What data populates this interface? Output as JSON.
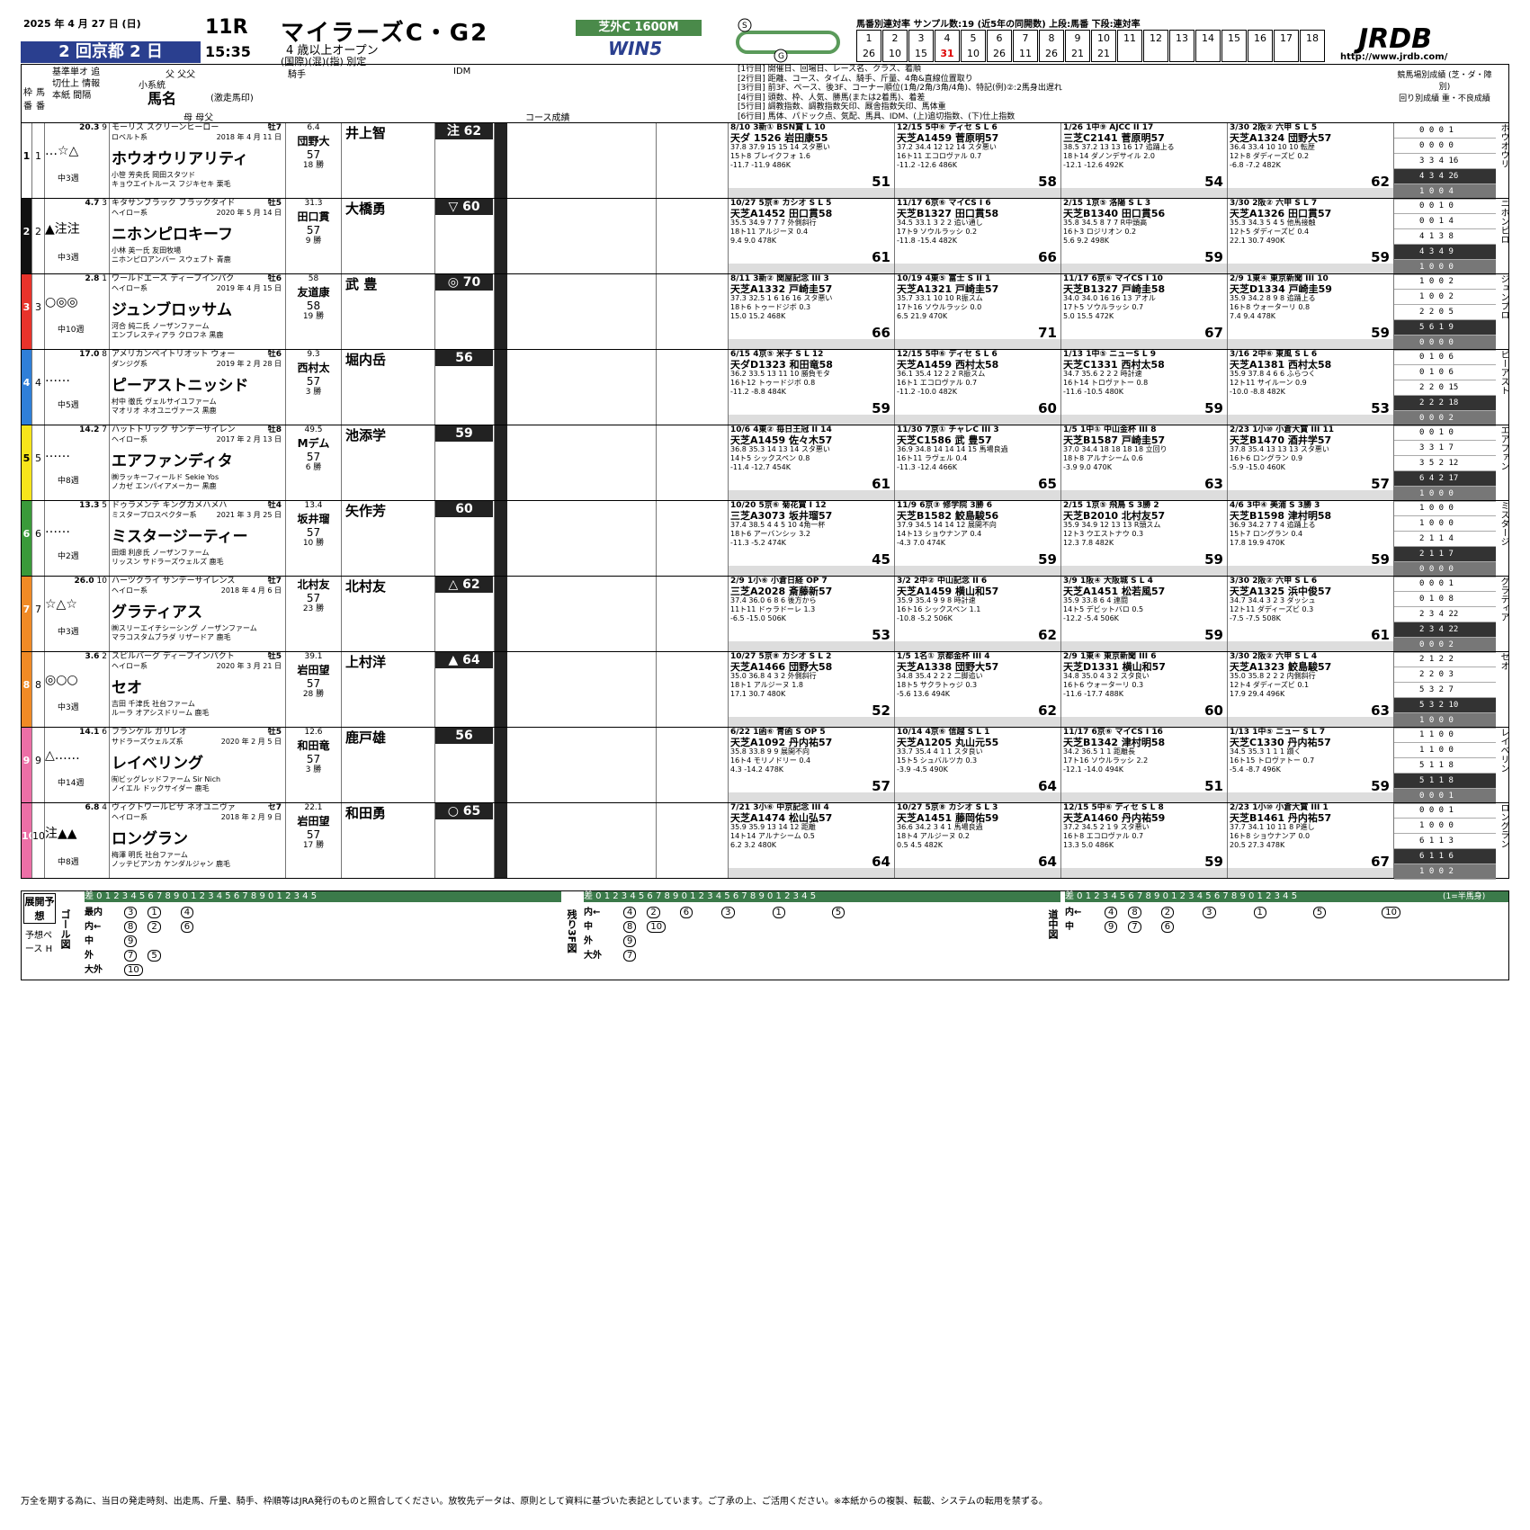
{
  "header": {
    "date": "2025 年 4 月 27 日 (日)",
    "meeting": "2 回京都 2 日",
    "race_no": "11R",
    "time": "15:35",
    "race_name": "マイラーズC・G2",
    "conditions_1": "4 歳以上オープン",
    "conditions_2": "(国際)(混)(指) 別定",
    "course": "芝外C 1600M",
    "win5": "WIN5",
    "stats_title": "馬番別連対率 サンプル数:19 (近5年の同開数) 上段:馬番 下段:連対率",
    "umaban_labels": [
      "1",
      "2",
      "3",
      "4",
      "5",
      "6",
      "7",
      "8",
      "9",
      "10",
      "11",
      "12",
      "13",
      "14",
      "15",
      "16",
      "17",
      "18"
    ],
    "rates": [
      "26",
      "10",
      "15",
      "31",
      "10",
      "26",
      "11",
      "26",
      "21",
      "21",
      "",
      "",
      "",
      "",
      "",
      "",
      "",
      ""
    ],
    "brand": "JRDB",
    "url": "http://www.jrdb.com/"
  },
  "columns": {
    "waku": "枠番",
    "umaban": "馬番",
    "mark_head": "基準単オ 追切仕上 情報本紙 間隔",
    "sire": "父 父父",
    "line": "小系統",
    "horse": "馬名",
    "horse_sub": "(激走馬印)",
    "dam": "母 母父",
    "jockey": "騎手",
    "idm": "IDM",
    "course_perf": "コース成績",
    "legend1": "[1行目] 開催日、回場日、レース名、クラス、着順",
    "legend2": "[2行目] 距離、コース、タイム、騎手、斤量、4角&直線位置取り",
    "legend3": "[3行目] 前3F、ペース、後3F、コーナー順位(1角/2角/3角/4角)、特記(例)②:2馬身出遅れ",
    "legend4": "[4行目] 頭数、枠、人気、勝馬(または2着馬)、着差",
    "legend5": "[5行目] 調教指数、調教指数矢印、厩舎指数矢印、馬体重",
    "legend6": "[6行目] 馬体、パドック点、気配、馬具、IDM、(上)追切指数、(下)仕上指数",
    "ranking_head": "競馬場別成績 (芝・ダ・障別)",
    "ranking_sub": "回り別成績 重・不良成績"
  },
  "horses": [
    {
      "waku": "1",
      "no": "1",
      "color": "#ffffff",
      "tc": "#000",
      "odds": "20.3",
      "pop": "9",
      "marks": "…☆△",
      "sire": "モーリス スクリーンヒーロー",
      "line": "ロベルト系",
      "age": "牡7",
      "birth": "2018 年 4 月 11 日",
      "name": "ホウオウリアリティ",
      "breeder": "小笹 芳央氏 岡田スタツド",
      "dam": "キョウエイトルース フジキセキ 栗毛",
      "interval": "中3週",
      "jockey": "井上智",
      "rate": "6.4",
      "trainer": "団野大",
      "weight": "57",
      "wins": "18 勝",
      "idm": "注 62",
      "place": "京芝",
      "rank": [
        "0 0 0 1",
        "0 0 0 0",
        "3 3 4 16",
        "4 3 4 26",
        "1 0 0 4"
      ],
      "vname": "ホウオウリ",
      "races": [
        {
          "t": "8/10 3新① BSN賞 L 10",
          "d": "天ダ 1526 岩田康55",
          "r": "37.8 37.9 15 15 14 スタ悪い",
          "n": "15ト8 ブレイクフォ 1.6",
          "w": "-11.7 -11.9 486K",
          "i": "51"
        },
        {
          "t": "12/15 5中⑥ ディセ S L 6",
          "d": "天芝A1459 菅原明57",
          "r": "37.2 34.4 12 12 14 スタ悪い",
          "n": "16ト11 エコロヴァル 0.7",
          "w": "-11.2 -12.6 486K",
          "i": "58"
        },
        {
          "t": "1/26 1中⑨ AJCC II 17",
          "d": "三芝C2141 菅原明57",
          "r": "38.5 37.2 13 13 16 17 追踊上る",
          "n": "18ト14 ダノンデサイル 2.0",
          "w": "-12.1 -12.6 492K",
          "i": "54"
        },
        {
          "t": "3/30 2阪② 六甲 S L 5",
          "d": "天芝A1324 団野大57",
          "r": "36.4 33.4 10 10 10 転歴",
          "n": "12ト8 ダディーズビ 0.2",
          "w": "-6.8 -7.2 482K",
          "i": "62"
        }
      ]
    },
    {
      "waku": "2",
      "no": "2",
      "color": "#111111",
      "tc": "#fff",
      "odds": "4.7",
      "pop": "3",
      "marks": "▲注注",
      "sire": "キタサンブラック ブラックタイド",
      "line": "ヘイロー系",
      "age": "牡5",
      "birth": "2020 年 5 月 14 日",
      "name": "ニホンピロキーフ",
      "breeder": "小林 英一氏 友田牧場",
      "dam": "ニホンピロアンバー スウェプト 青鹿",
      "interval": "中3週",
      "jockey": "大橋勇",
      "rate": "31.3",
      "trainer": "田口貫",
      "weight": "57",
      "wins": "9 勝",
      "idm": "▽ 60",
      "place": "京芝",
      "rank": [
        "0 0 1 0",
        "0 0 1 4",
        "4 1 3 8",
        "4 3 4 9",
        "1 0 0 0"
      ],
      "vname": "ニホンピロ",
      "races": [
        {
          "t": "10/27 5京⑧ カシオ S L 5",
          "d": "天芝A1452 田口貫58",
          "r": "35.5 34.9 7 7 7 外側斜行",
          "n": "18ト11 アルジーヌ 0.4",
          "w": "9.4 9.0 478K",
          "i": "61"
        },
        {
          "t": "11/17 6京⑥ マイCS I 6",
          "d": "天芝B1327 田口貫58",
          "r": "34.5 33.1 3 2 2 追い通し",
          "n": "17ト9 ソウルラッシ 0.2",
          "w": "-11.8 -15.4 482K",
          "i": "66"
        },
        {
          "t": "2/15 1京⑤ 洛陽 S L 3",
          "d": "天芝B1340 田口貫56",
          "r": "35.8 34.5 8 7 7 R中頭高",
          "n": "16ト3 ロジリオン 0.2",
          "w": "5.6 9.2 498K",
          "i": "59"
        },
        {
          "t": "3/30 2阪② 六甲 S L 7",
          "d": "天芝A1326 田口貫57",
          "r": "35.3 34.3 5 4 5 他馬接触",
          "n": "12ト5 ダディーズビ 0.4",
          "w": "22.1 30.7 490K",
          "i": "59"
        }
      ]
    },
    {
      "waku": "3",
      "no": "3",
      "color": "#e8332b",
      "tc": "#fff",
      "odds": "2.8",
      "pop": "1",
      "marks": "○◎◎",
      "sire": "ワールドエース ディープインパク",
      "line": "ヘイロー系",
      "age": "牡6",
      "birth": "2019 年 4 月 15 日",
      "name": "ジュンブロッサム",
      "breeder": "河合 純二氏 ノーザンファーム",
      "dam": "エンブレスティアラ クロフネ 黒鹿",
      "interval": "中10週",
      "jockey": "武 豊",
      "rate": "58",
      "trainer": "友道康",
      "weight": "58",
      "wins": "19 勝",
      "idm": "◎ 70",
      "place": "京芝",
      "rank": [
        "1 0 0 2",
        "1 0 0 2",
        "2 2 0 5",
        "5 6 1 9",
        "0 0 0 0"
      ],
      "vname": "ジュンブロ",
      "races": [
        {
          "t": "8/11 3新② 関屋記念 III 3",
          "d": "天芝A1332 戸崎圭57",
          "r": "37.3 32.5 1 6 16 16 スタ悪い",
          "n": "18ト6 トゥードジボ 0.3",
          "w": "15.0 15.2 468K",
          "i": "66"
        },
        {
          "t": "10/19 4東⑤ 富士 S II 1",
          "d": "天芝A1321 戸崎圭57",
          "r": "35.7 33.1 10 10 R振スム",
          "n": "17ト16 ソウルラッシ 0.0",
          "w": "6.5 21.9 470K",
          "i": "71"
        },
        {
          "t": "11/17 6京⑥ マイCS I 10",
          "d": "天芝B1327 戸崎圭58",
          "r": "34.0 34.0 16 16 13 アオル",
          "n": "17ト5 ソウルラッシ 0.7",
          "w": "5.0 15.5 472K",
          "i": "67"
        },
        {
          "t": "2/9 1東④ 東京新聞 III 10",
          "d": "天芝D1334 戸崎圭59",
          "r": "35.9 34.2 8 9 8 追踊上る",
          "n": "16ト8 ウォーターリ 0.8",
          "w": "7.4 9.4 478K",
          "i": "59"
        }
      ]
    },
    {
      "waku": "4",
      "no": "4",
      "color": "#2f7fd8",
      "tc": "#fff",
      "odds": "17.0",
      "pop": "8",
      "marks": "……",
      "sire": "アメリカンペイトリオット ウォー",
      "line": "ダンジグ系",
      "age": "牡6",
      "birth": "2019 年 2 月 28 日",
      "name": "ピーアストニッシド",
      "breeder": "村中 徹氏 ヴェルサイユファーム",
      "dam": "マオリオ ネオユニヴァース 黒鹿",
      "interval": "中5週",
      "jockey": "堀内岳",
      "rate": "9.3",
      "trainer": "西村太",
      "weight": "57",
      "wins": "3 勝",
      "idm": "56",
      "place": "京芝",
      "rank": [
        "0 1 0 6",
        "0 1 0 6",
        "2 2 0 15",
        "2 2 2 18",
        "0 0 0 2"
      ],
      "vname": "ピーアスト",
      "races": [
        {
          "t": "6/15 4京⑤ 米子 S L 12",
          "d": "天ダD1323 和田竜58",
          "r": "36.2 33.5 13 11 10 勝負モタ",
          "n": "16ト12 トゥードジボ 0.8",
          "w": "-11.2 -8.8 484K",
          "i": "59"
        },
        {
          "t": "12/15 5中⑥ ディセ S L 6",
          "d": "天芝A1459 西村太58",
          "r": "36.1 35.4 12 2 2 R振スム",
          "n": "16ト1 エコロヴァル 0.7",
          "w": "-11.2 -10.0 482K",
          "i": "60"
        },
        {
          "t": "1/13 1中⑤ ニューS L 9",
          "d": "天芝C1331 西村太58",
          "r": "34.7 35.6 2 2 2 時計速",
          "n": "16ト14 トロヴァトー 0.8",
          "w": "-11.6 -10.5 480K",
          "i": "59"
        },
        {
          "t": "3/16 2中⑥ 東風 S L 6",
          "d": "天芝A1381 西村太58",
          "r": "35.9 37.8 4 6 6 ふらつく",
          "n": "12ト11 サイルーン 0.9",
          "w": "-10.0 -8.8 482K",
          "i": "53"
        }
      ]
    },
    {
      "waku": "5",
      "no": "5",
      "color": "#f7e51b",
      "tc": "#000",
      "odds": "14.2",
      "pop": "7",
      "marks": "……",
      "sire": "ハットトリック サンデーサイレン",
      "line": "ヘイロー系",
      "age": "牡8",
      "birth": "2017 年 2 月 13 日",
      "name": "エアファンディタ",
      "breeder": "㈱ラッキーフィールド Sekie Yos",
      "dam": "ノカゼ エンパイアメーカー 黒鹿",
      "interval": "中8週",
      "jockey": "池添学",
      "rate": "49.5",
      "trainer": "Mデム",
      "weight": "57",
      "wins": "6 勝",
      "idm": "59",
      "place": "京芝",
      "rank": [
        "0 0 1 0",
        "3 3 1 7",
        "3 5 2 12",
        "6 4 2 17",
        "1 0 0 0"
      ],
      "vname": "エアファン",
      "races": [
        {
          "t": "10/6 4東② 毎日王冠 II 14",
          "d": "天芝A1459 佐々木57",
          "r": "36.8 35.3 14 13 14 スタ悪い",
          "n": "14ト5 シックスペン 0.8",
          "w": "-11.4 -12.7 454K",
          "i": "61"
        },
        {
          "t": "11/30 7京① チャレC III 3",
          "d": "天芝C1586 武 豊57",
          "r": "36.9 34.8 14 14 14 15 馬場良過",
          "n": "16ト11 ラヴェル 0.4",
          "w": "-11.3 -12.4 466K",
          "i": "65"
        },
        {
          "t": "1/5 1中① 中山金杯 III 8",
          "d": "天芝B1587 戸崎圭57",
          "r": "37.0 34.4 18 18 18 18 立回り",
          "n": "18ト8 アルナシーム 0.6",
          "w": "-3.9 9.0 470K",
          "i": "63"
        },
        {
          "t": "2/23 1小⑩ 小倉大賞 III 11",
          "d": "天芝B1470 酒井学57",
          "r": "37.8 35.4 13 13 13 スタ悪い",
          "n": "16ト6 ロングラン 0.9",
          "w": "-5.9 -15.0 460K",
          "i": "57"
        }
      ]
    },
    {
      "waku": "6",
      "no": "6",
      "color": "#3a9a3a",
      "tc": "#fff",
      "odds": "13.3",
      "pop": "5",
      "marks": "……",
      "sire": "ドゥラメンテ キングカメハメハ",
      "line": "ミスタープロスペクター系",
      "age": "牡4",
      "birth": "2021 年 3 月 25 日",
      "name": "ミスタージーティー",
      "breeder": "田畑 利彦氏 ノーザンファーム",
      "dam": "リッスン サドラーズウェルズ 鹿毛",
      "interval": "中2週",
      "jockey": "矢作芳",
      "rate": "13.4",
      "trainer": "坂井瑠",
      "weight": "57",
      "wins": "10 勝",
      "idm": "60",
      "place": "京芝",
      "rank": [
        "1 0 0 0",
        "1 0 0 0",
        "2 1 1 4",
        "2 1 1 7",
        "0 0 0 0"
      ],
      "vname": "ミスタージ",
      "races": [
        {
          "t": "10/20 5京⑥ 菊花賞 I 12",
          "d": "三芝A3073 坂井瑠57",
          "r": "37.4 38.5 4 4 5 10 4角一杯",
          "n": "18ト6 アーバンシッ 3.2",
          "w": "-11.3 -5.2 474K",
          "i": "45"
        },
        {
          "t": "11/9 6京③ 修学院 3勝 6",
          "d": "天芝B1582 鮫島駿56",
          "r": "37.9 34.5 14 14 12 展開不向",
          "n": "14ト13 ショウナンア 0.4",
          "w": "-4.3 7.0 474K",
          "i": "59"
        },
        {
          "t": "2/15 1京⑤ 飛鳥 S 3勝 2",
          "d": "天芝B2010 北村友57",
          "r": "35.9 34.9 12 13 13 R頭スム",
          "n": "12ト3 ウエストナウ 0.3",
          "w": "12.3 7.8 482K",
          "i": "59"
        },
        {
          "t": "4/6 3中④ 美浦 S 3勝 3",
          "d": "天芝B1598 津村明58",
          "r": "36.9 34.2 7 7 4 追踊上る",
          "n": "15ト7 ロングラン 0.4",
          "w": "17.8 19.9 470K",
          "i": "59"
        }
      ]
    },
    {
      "waku": "7",
      "no": "7",
      "color": "#f08a25",
      "tc": "#fff",
      "odds": "26.0",
      "pop": "10",
      "marks": "☆△☆",
      "sire": "ハーツクライ サンデーサイレンス",
      "line": "ヘイロー系",
      "age": "牡7",
      "birth": "2018 年 4 月 6 日",
      "name": "グラティアス",
      "breeder": "㈱スリーエイチシーシング ノーザンファーム",
      "dam": "マラコスタムブラダ リザードア 鹿毛",
      "interval": "中3週",
      "jockey": "北村友",
      "rate": "",
      "trainer": "北村友",
      "weight": "57",
      "wins": "23 勝",
      "idm": "△ 62",
      "place": "京芝",
      "rank": [
        "0 0 0 1",
        "0 1 0 8",
        "2 3 4 22",
        "2 3 4 22",
        "0 0 0 2"
      ],
      "vname": "グラティア",
      "races": [
        {
          "t": "2/9 1小⑥ 小倉日経 OP 7",
          "d": "三芝A2028 斎藤新57",
          "r": "37.4 36.0 6 8 6 後方から",
          "n": "11ト11 ドゥラドーレ 1.3",
          "w": "-6.5 -15.0 506K",
          "i": "53"
        },
        {
          "t": "3/2 2中② 中山記念 II 6",
          "d": "天芝A1459 横山和57",
          "r": "35.9 35.4 9 9 8 時計速",
          "n": "16ト16 シックスペン 1.1",
          "w": "-10.8 -5.2 506K",
          "i": "62"
        },
        {
          "t": "3/9 1阪④ 大阪城 S L 4",
          "d": "天芝A1451 松若風57",
          "r": "35.9 33.8 6 4 連闘",
          "n": "14ト5 デビットバロ 0.5",
          "w": "-12.2 -5.4 506K",
          "i": "59"
        },
        {
          "t": "3/30 2阪② 六甲 S L 6",
          "d": "天芝A1325 浜中俊57",
          "r": "34.7 34.4 3 2 3 ダッシュ",
          "n": "12ト11 ダディーズビ 0.3",
          "w": "-7.5 -7.5 508K",
          "i": "61"
        }
      ]
    },
    {
      "waku": "8",
      "no": "8",
      "color": "#f08a25",
      "tc": "#fff",
      "odds": "3.6",
      "pop": "2",
      "marks": "◎○○",
      "sire": "スピルバーグ ディープインパクト",
      "line": "ヘイロー系",
      "age": "牡5",
      "birth": "2020 年 3 月 21 日",
      "name": "セオ",
      "breeder": "吉田 千津氏 社台ファーム",
      "dam": "ルーラ オアシスドリーム 鹿毛",
      "interval": "中3週",
      "jockey": "上村洋",
      "rate": "39.1",
      "trainer": "岩田望",
      "weight": "57",
      "wins": "28 勝",
      "idm": "▲ 64",
      "place": "京芝",
      "rank": [
        "2 1 2 2",
        "2 2 0 3",
        "5 3 2 7",
        "5 3 2 10",
        "1 0 0 0"
      ],
      "vname": "セオ",
      "races": [
        {
          "t": "10/27 5京⑧ カシオ S L 2",
          "d": "天芝A1466 団野大58",
          "r": "35.0 36.8 4 3 2 外側斜行",
          "n": "18ト1 アルジーヌ 1.8",
          "w": "17.1 30.7 480K",
          "i": "52"
        },
        {
          "t": "1/5 1名① 京都金杯 III 4",
          "d": "天芝A1338 団野大57",
          "r": "34.8 35.4 2 2 2 二脚追い",
          "n": "18ト5 サクラトゥジ 0.3",
          "w": "-5.6 13.6 494K",
          "i": "62"
        },
        {
          "t": "2/9 1東④ 東京新聞 III 6",
          "d": "天芝D1331 横山和57",
          "r": "34.8 35.0 4 3 2 スタ良い",
          "n": "16ト6 ウォーターリ 0.3",
          "w": "-11.6 -17.7 488K",
          "i": "60"
        },
        {
          "t": "3/30 2阪② 六甲 S L 4",
          "d": "天芝A1323 鮫島駿57",
          "r": "35.0 35.8 2 2 2 内側斜行",
          "n": "12ト4 ダディーズビ 0.1",
          "w": "17.9 29.4 496K",
          "i": "63"
        }
      ]
    },
    {
      "waku": "9",
      "no": "9",
      "color": "#ec6fa6",
      "tc": "#fff",
      "odds": "14.1",
      "pop": "6",
      "marks": "△……",
      "sire": "フランケル ガリレオ",
      "line": "サドラーズウェルズ系",
      "age": "牡5",
      "birth": "2020 年 2 月 5 日",
      "name": "レイベリング",
      "breeder": "㈲ビッグレッドファーム Sir Nich",
      "dam": "ノイエル ドックサイダー 鹿毛",
      "interval": "中14週",
      "jockey": "鹿戸雄",
      "rate": "12.6",
      "trainer": "和田竜",
      "weight": "57",
      "wins": "3 勝",
      "idm": "56",
      "place": "京芝",
      "rank": [
        "1 1 0 0",
        "1 1 0 0",
        "5 1 1 8",
        "5 1 1 8",
        "0 0 0 1"
      ],
      "vname": "レイベリン",
      "races": [
        {
          "t": "6/22 1函⑥ 青函 S OP 5",
          "d": "天芝A1092 丹内祐57",
          "r": "35.8 33.8 9 9 展開不向",
          "n": "16ト4 モリノドリー 0.4",
          "w": "4.3 -14.2 478K",
          "i": "57"
        },
        {
          "t": "10/14 4京⑥ 信越 S L 1",
          "d": "天芝A1205 丸山元55",
          "r": "33.7 35.4 4 1 1 スタ良い",
          "n": "15ト5 シュバルツカ 0.3",
          "w": "-3.9 -4.5 490K",
          "i": "64"
        },
        {
          "t": "11/17 6京⑥ マイCS I 16",
          "d": "天芝B1342 津村明58",
          "r": "34.2 36.5 1 1 距離長",
          "n": "17ト16 ソウルラッシ 2.2",
          "w": "-12.1 -14.0 494K",
          "i": "51"
        },
        {
          "t": "1/13 1中⑤ ニュー S L 7",
          "d": "天芝C1330 丹内祐57",
          "r": "34.5 35.3 1 1 1 躓く",
          "n": "16ト15 トロヴァトー 0.7",
          "w": "-5.4 -8.7 496K",
          "i": "59"
        }
      ]
    },
    {
      "waku": "10",
      "no": "10",
      "color": "#ec6fa6",
      "tc": "#fff",
      "odds": "6.8",
      "pop": "4",
      "marks": "注▲▲",
      "sire": "ヴィクトワールピサ ネオユニヴァ",
      "line": "ヘイロー系",
      "age": "セ7",
      "birth": "2018 年 2 月 9 日",
      "name": "ロングラン",
      "breeder": "梅澤 明氏 社台ファーム",
      "dam": "ノッテビアンカ ケンダルジャン 鹿毛",
      "interval": "中8週",
      "jockey": "和田勇",
      "rate": "22.1",
      "trainer": "岩田望",
      "weight": "57",
      "wins": "17 勝",
      "idm": "○ 65",
      "place": "京芝",
      "rank": [
        "0 0 0 1",
        "1 0 0 0",
        "6 1 1 3",
        "6 1 1 6",
        "1 0 0 2"
      ],
      "vname": "ロングラン",
      "races": [
        {
          "t": "7/21 3小⑥ 中京記念 III 4",
          "d": "天芝A1474 松山弘57",
          "r": "35.9 35.9 13 14 12 距離",
          "n": "14ト14 アルナシーム 0.5",
          "w": "6.2 3.2 480K",
          "i": "64"
        },
        {
          "t": "10/27 5京⑧ カシオ S L 3",
          "d": "天芝A1451 藤岡佑59",
          "r": "36.6 34.2 3 4 1 馬場良過",
          "n": "18ト4 アルジーヌ 0.2",
          "w": "0.5 4.5 482K",
          "i": "64"
        },
        {
          "t": "12/15 5中⑥ ディセ S L 8",
          "d": "天芝A1460 丹内祐59",
          "r": "37.2 34.5 2 1 9 スタ悪い",
          "n": "16ト8 エコロヴァル 0.7",
          "w": "13.3 5.0 486K",
          "i": "59"
        },
        {
          "t": "2/23 1小⑩ 小倉大賞 III 1",
          "d": "天芝B1461 丹内祐57",
          "r": "37.7 34.1 10 11 8 P進し",
          "n": "16ト8 ショウナンア 0.0",
          "w": "20.5 27.3 478K",
          "i": "67"
        }
      ]
    }
  ],
  "pace": {
    "title": "展開予想",
    "pace_label": "予想ペース H",
    "goal_label": "ゴール図",
    "last3f_label": "残り3F図",
    "midway_label": "道中図",
    "scale": "差 0 1 2 3 4 5 6 7 8 9 0 1 2 3 4 5 6 7 8 9 0 1 2 3 4 5",
    "scale_note": "(1=半馬身)",
    "lanes": [
      "最内",
      "内←",
      "中",
      "外",
      "大外"
    ],
    "goal_rows": [
      [
        "3",
        "1",
        "4"
      ],
      [
        "8",
        "2",
        "6"
      ],
      [
        "9"
      ],
      [
        "7",
        "5"
      ],
      [
        "10"
      ]
    ],
    "last3f_rows": [
      [
        "4",
        "2",
        "6",
        "3",
        "1",
        "5"
      ],
      [
        "8",
        "10"
      ],
      [
        "9"
      ],
      [
        "7"
      ]
    ],
    "midway_rows": [
      [
        "4",
        "8",
        "2",
        "3",
        "1",
        "5",
        "10"
      ],
      [
        "9",
        "7",
        "6"
      ]
    ]
  },
  "footer": "万全を期する為に、当日の発走時刻、出走馬、斤量、騎手、枠順等はJRA発行のものと照合してください。放牧先データは、原則として資料に基づいた表記としています。ご了承の上、ご活用ください。※本紙からの複製、転載、システムの転用を禁ずる。"
}
